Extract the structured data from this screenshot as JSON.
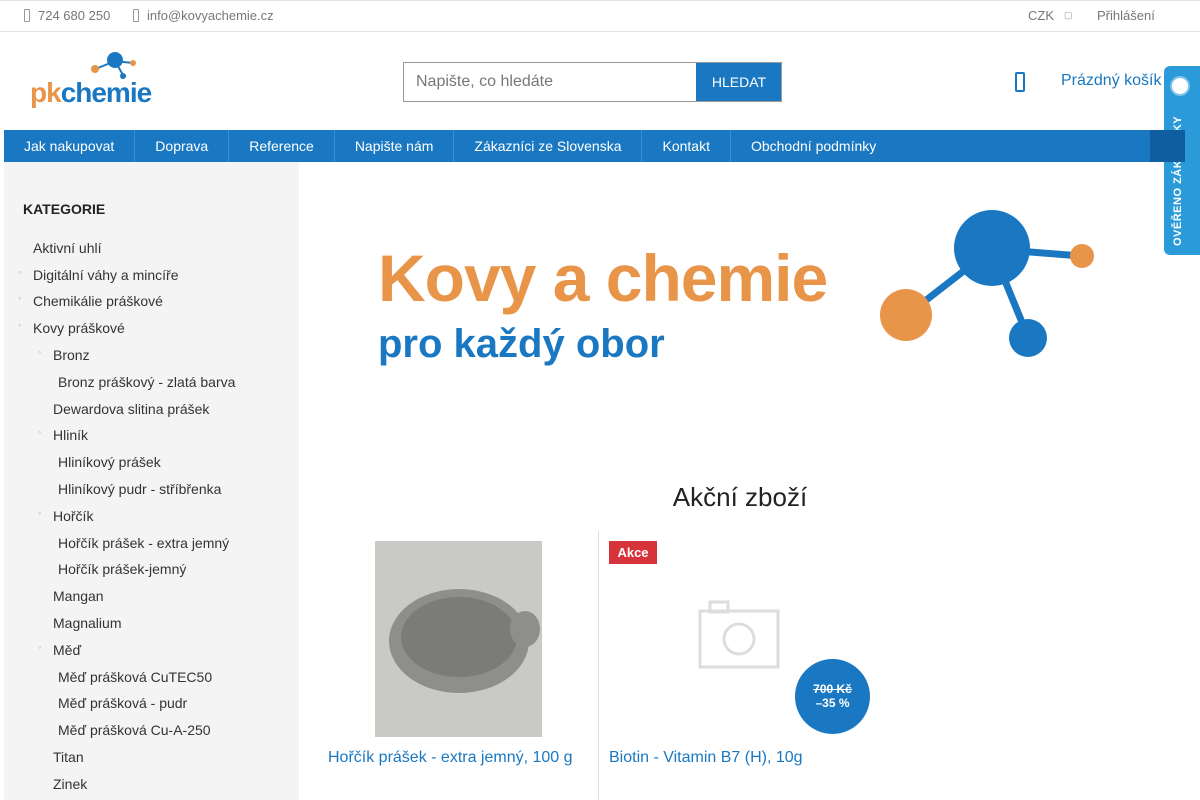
{
  "topbar": {
    "phone": "724 680 250",
    "email": "info@kovyachemie.cz",
    "currency": "CZK",
    "login": "Přihlášení"
  },
  "header": {
    "logo_pk": "pk",
    "logo_chemie": "chemie",
    "search_placeholder": "Napište, co hledáte",
    "search_button": "HLEDAT",
    "cart": "Prázdný košík"
  },
  "nav": {
    "items": [
      "Jak nakupovat",
      "Doprava",
      "Reference",
      "Napište nám",
      "Zákazníci ze Slovenska",
      "Kontakt",
      "Obchodní podmínky"
    ]
  },
  "badge": {
    "text": "OVĚŘENO ZÁKAZNÍKY"
  },
  "sidebar": {
    "title": "KATEGORIE",
    "items": [
      "Aktivní uhlí",
      "Digitální váhy a mincíře",
      "Chemikálie práškové",
      "Kovy práškové",
      "Bronz",
      "Bronz práškový - zlatá barva",
      "Dewardova slitina prášek",
      "Hliník",
      "Hliníkový prášek",
      "Hliníkový pudr - stříbřenka",
      "Hořčík",
      "Hořčík prášek - extra jemný",
      "Hořčík prášek-jemný",
      "Mangan",
      "Magnalium",
      "Měď",
      "Měď prášková CuTEC50",
      "Měď prášková - pudr",
      "Měď prášková Cu-A-250",
      "Titan",
      "Zinek"
    ]
  },
  "banner": {
    "line1": "Kovy a chemie",
    "line2": "pro každý obor"
  },
  "section": {
    "title": "Akční zboží"
  },
  "products": [
    {
      "name": "Hořčík prášek - extra jemný, 100 g"
    },
    {
      "name": "Biotin - Vitamin B7 (H), 10g",
      "tag": "Akce",
      "old_price": "700 Kč",
      "discount": "–35 %"
    }
  ],
  "colors": {
    "brand_blue": "#1a78c2",
    "brand_orange": "#e8954a",
    "sale_red": "#d6333a"
  }
}
